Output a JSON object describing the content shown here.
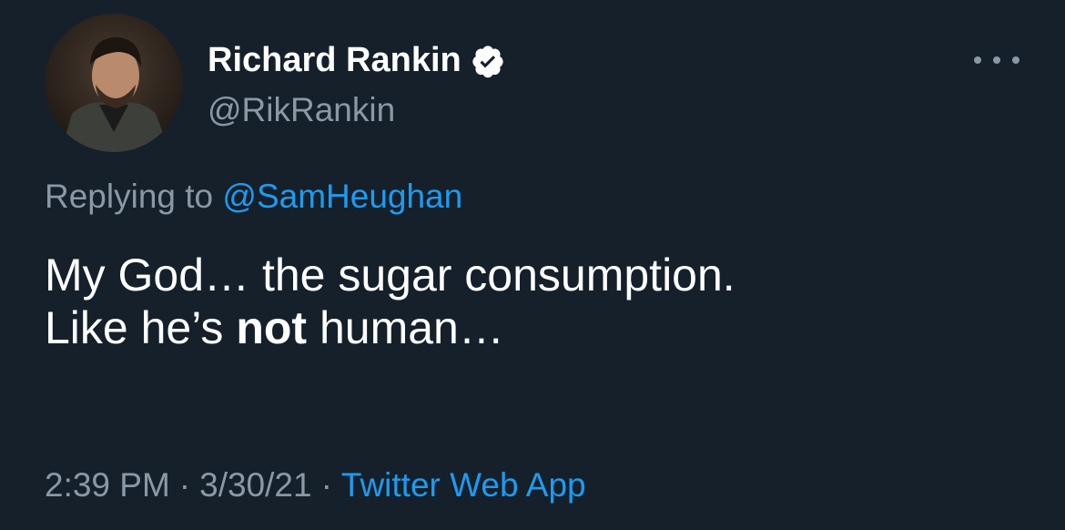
{
  "author": {
    "display_name": "Richard Rankin",
    "handle": "@RikRankin",
    "verified": true,
    "avatar_icon": "profile-photo"
  },
  "reply": {
    "prefix": "Replying to",
    "mention": "@SamHeughan"
  },
  "tweet": {
    "line1": "My God… the sugar consumption.",
    "line2_start": "Like he’s",
    "line2_bold": "not",
    "line2_end": "human…"
  },
  "meta": {
    "time": "2:39 PM",
    "separator": "·",
    "date": "3/30/21",
    "source": "Twitter Web App"
  },
  "icons": {
    "more": "more-horizontal-icon",
    "verified": "verified-badge-icon"
  },
  "colors": {
    "background": "#15202b",
    "primary_text": "#ffffff",
    "secondary_text": "#8b98a5",
    "accent": "#1d9bf0"
  }
}
